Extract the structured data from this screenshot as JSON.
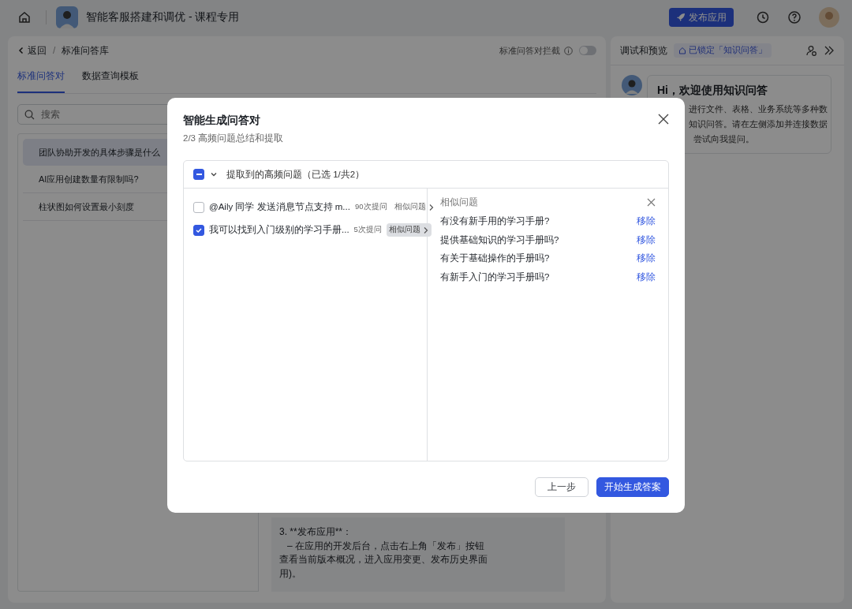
{
  "top_bar": {
    "title": "智能客服搭建和调优 - 课程专用",
    "publish_button": "发布应用"
  },
  "main_panel": {
    "back": "返回",
    "separator": "/",
    "breadcrumb": "标准问答库",
    "intercept_label": "标准问答对拦截",
    "intercept_on": false,
    "tabs": [
      {
        "label": "标准问答对",
        "selected": true
      },
      {
        "label": "数据查询模板",
        "selected": false
      }
    ],
    "search": {
      "placeholder": "搜索"
    },
    "questions": [
      {
        "text": "团队协助开发的具体步骤是什么",
        "selected": true
      },
      {
        "text": "AI应用创建数量有限制吗?",
        "selected": false
      },
      {
        "text": "柱状图如何设置最小刻度",
        "selected": false
      }
    ],
    "answer_lines": [
      "3. **发布应用**：",
      "   – 在应用的开发后台，点击右上角「发布」按钮",
      "查看当前版本概况，进入应用变更、发布历史界面",
      "用)。"
    ]
  },
  "preview_panel": {
    "title": "调试和预览",
    "lock_badge": "已锁定「知识问答」",
    "greeting": "Hi，欢迎使用知识问答",
    "message_lines": [
      "进行文件、表格、业务系统等多种数",
      "知识问答。请在左侧添加并连接数据",
      "尝试向我提问。"
    ]
  },
  "dialog": {
    "title": "智能生成问答对",
    "subtitle": "2/3 高频问题总结和提取",
    "group": {
      "label": "提取到的高频问题（已选 1/共2）",
      "indeterminate": true,
      "expanded": true
    },
    "items": [
      {
        "text": "@Aily 同学 发送消息节点支持 m...",
        "count": "90次提问",
        "similar_label": "相似问题",
        "checked": false,
        "selected": false
      },
      {
        "text": "我可以找到入门级别的学习手册...",
        "count": "5次提问",
        "similar_label": "相似问题",
        "checked": true,
        "selected": true
      }
    ],
    "similar": {
      "title": "相似问题",
      "items": [
        {
          "text": "有没有新手用的学习手册?",
          "action": "移除"
        },
        {
          "text": "提供基础知识的学习手册吗?",
          "action": "移除"
        },
        {
          "text": "有关于基础操作的手册吗?",
          "action": "移除"
        },
        {
          "text": "有新手入门的学习手册吗?",
          "action": "移除"
        }
      ]
    },
    "buttons": {
      "back": "上一步",
      "primary": "开始生成答案"
    }
  }
}
